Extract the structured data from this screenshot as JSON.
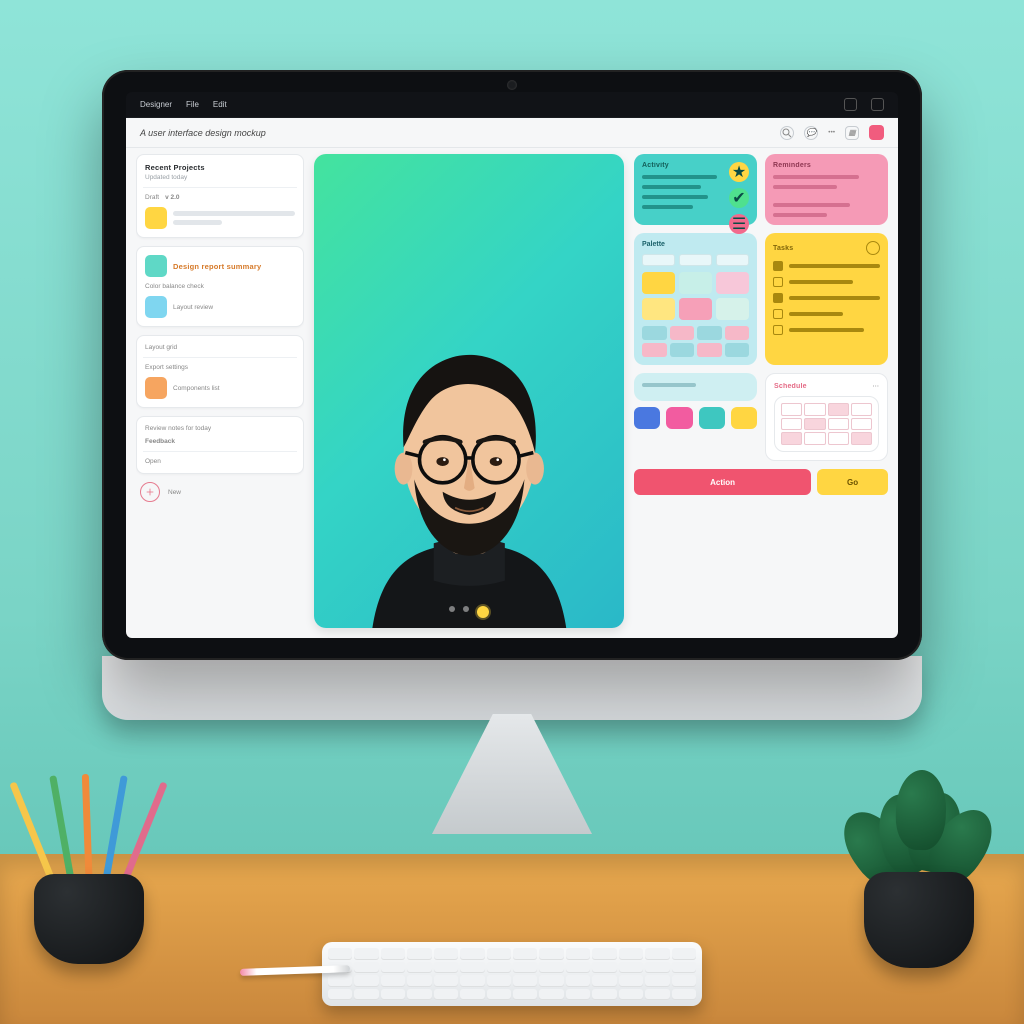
{
  "os": {
    "app_name": "Designer",
    "menu": [
      "File",
      "Edit"
    ]
  },
  "header": {
    "title": "A user interface design mockup"
  },
  "sidebar": {
    "card1": {
      "title": "Recent Projects",
      "sub": "Updated today",
      "meta_a": "Draft",
      "meta_b": "v 2.0"
    },
    "card2": {
      "title": "Design report summary",
      "line2": "Color balance check",
      "line3": "Layout review"
    },
    "card3": {
      "line1": "Layout grid",
      "line2": "Export settings",
      "line3": "Components list"
    },
    "card4": {
      "line1": "Review notes for today",
      "line2": "Feedback",
      "foot": "Open"
    },
    "add_label": "New"
  },
  "cards": {
    "teal": {
      "title": "Activity"
    },
    "pink": {
      "title": "Reminders"
    },
    "palette": {
      "title": "Palette"
    },
    "yellow": {
      "title": "Tasks"
    },
    "white": {
      "title": "Schedule"
    }
  },
  "cta": {
    "primary": "Action",
    "secondary": "Go"
  },
  "colors": {
    "accent_pink": "#f0546f",
    "accent_yellow": "#ffd642",
    "accent_teal": "#3ec7c0"
  }
}
